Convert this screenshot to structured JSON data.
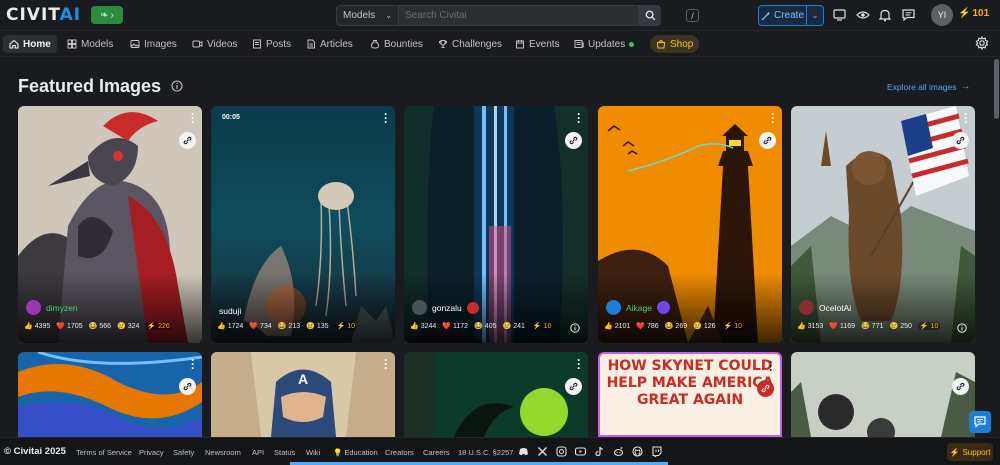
{
  "brand": {
    "logo_main": "CIVIT",
    "logo_accent": "AI"
  },
  "search": {
    "scope": "Models",
    "placeholder": "Search Civitai",
    "shortcut": "/"
  },
  "header": {
    "create_label": "Create",
    "avatar_initials": "YI",
    "buzz_balance": "101"
  },
  "nav": {
    "items": [
      {
        "label": "Home",
        "icon": "home-icon",
        "active": true
      },
      {
        "label": "Models",
        "icon": "layers-icon"
      },
      {
        "label": "Images",
        "icon": "photo-icon"
      },
      {
        "label": "Videos",
        "icon": "video-icon"
      },
      {
        "label": "Posts",
        "icon": "posts-icon"
      },
      {
        "label": "Articles",
        "icon": "article-icon"
      },
      {
        "label": "Bounties",
        "icon": "moneybag-icon"
      },
      {
        "label": "Challenges",
        "icon": "trophy-icon"
      },
      {
        "label": "Events",
        "icon": "calendar-icon"
      },
      {
        "label": "Updates",
        "icon": "news-icon"
      },
      {
        "label": "Shop",
        "icon": "shopping-bag-icon"
      }
    ]
  },
  "featured": {
    "title": "Featured Images",
    "explore_label": "Explore all images",
    "cards": [
      {
        "user": "dimyzen",
        "duration": "",
        "stats": {
          "like": "4395",
          "heart": "1705",
          "laugh": "566",
          "cry": "324",
          "buzz": "226"
        }
      },
      {
        "user": "suduji",
        "duration": "00:05",
        "stats": {
          "like": "1724",
          "heart": "734",
          "laugh": "213",
          "cry": "135",
          "buzz": "10"
        }
      },
      {
        "user": "gonzalu",
        "duration": "",
        "stats": {
          "like": "3244",
          "heart": "1172",
          "laugh": "405",
          "cry": "241",
          "buzz": "10"
        }
      },
      {
        "user": "Aikage",
        "duration": "",
        "stats": {
          "like": "2101",
          "heart": "786",
          "laugh": "269",
          "cry": "126",
          "buzz": "10"
        }
      },
      {
        "user": "OcelotAi",
        "duration": "",
        "stats": {
          "like": "3153",
          "heart": "1169",
          "laugh": "771",
          "cry": "250",
          "buzz": "10"
        }
      }
    ],
    "poster_text": "HOW SKYNET COULD HELP MAKE AMERICA GREAT AGAIN"
  },
  "footer": {
    "copyright": "© Civitai 2025",
    "links": [
      "Terms of Service",
      "Privacy",
      "Safety",
      "Newsroom",
      "API",
      "Status",
      "Wiki",
      "Education",
      "Creators",
      "Careers",
      "18 U.S.C. §2257"
    ],
    "support_label": "Support"
  },
  "colors": {
    "accent": "#228be6",
    "buzz": "#fab005",
    "background": "#1a1b1e"
  }
}
